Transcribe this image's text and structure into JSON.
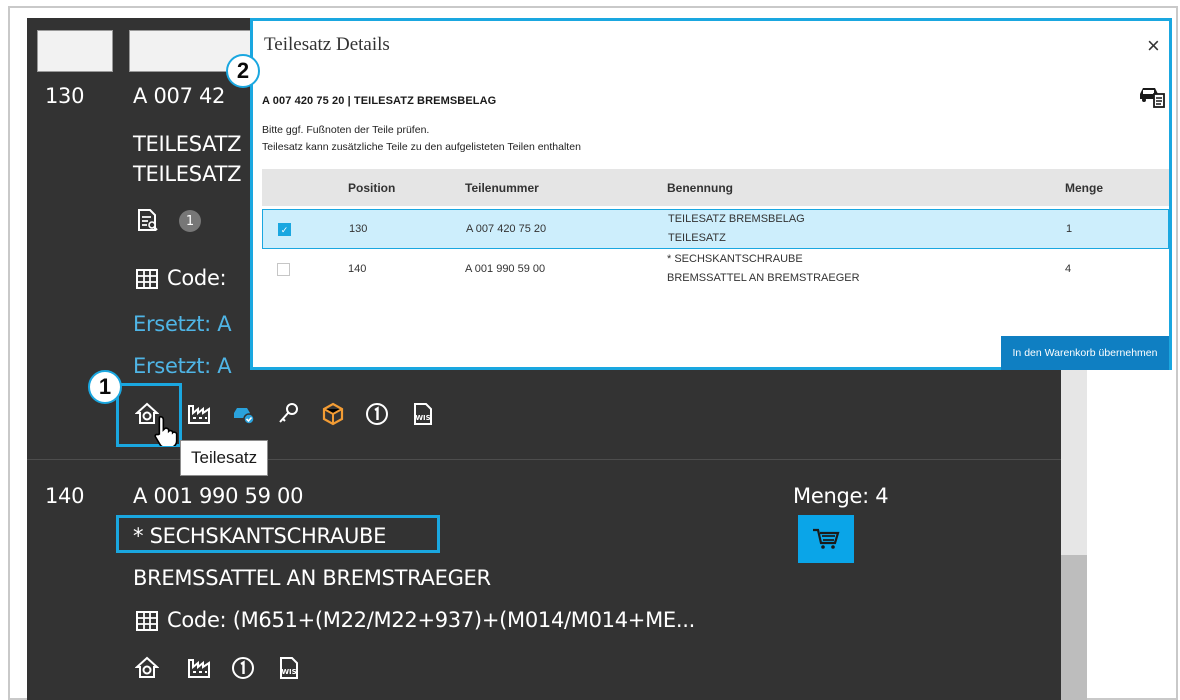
{
  "colors": {
    "accent": "#1aa7e0",
    "panel": "#333333",
    "link": "#4fb5e6",
    "cart_button": "#0aa5e8",
    "box_orange": "#f39c34",
    "car_blue": "#2aa2dc"
  },
  "list": {
    "items": [
      {
        "position": "130",
        "part_number": "A 007 42",
        "name_1": "TEILESATZ",
        "name_2": "TEILESATZ",
        "footnote_count": "1",
        "code_label": "Code:",
        "replaced_1": "Ersetzt: A",
        "replaced_2": "Ersetzt: A",
        "icons": [
          "parts-set-icon",
          "factory-icon",
          "car-check-icon",
          "key-icon",
          "package-icon",
          "info-icon",
          "wis-document-icon"
        ]
      },
      {
        "position": "140",
        "part_number": "A 001 990 59 00",
        "name_1": "* SECHSKANTSCHRAUBE",
        "name_2": "BREMSSATTEL AN BREMSTRAEGER",
        "code": "Code: (M651+(M22/M22+937)+(M014/M014+ME...",
        "quantity": "Menge: 4",
        "icons": [
          "parts-set-icon",
          "factory-icon",
          "info-icon",
          "wis-document-icon"
        ]
      }
    ]
  },
  "tooltip": {
    "text": "Teilesatz"
  },
  "callouts": {
    "one": "1",
    "two": "2"
  },
  "modal": {
    "title": "Teilesatz Details",
    "close": "×",
    "part_header": "A 007 420 75 20 | TEILESATZ BREMSBELAG",
    "note_1": "Bitte ggf. Fußnoten der Teile prüfen.",
    "note_2": "Teilesatz kann zusätzliche Teile zu den aufgelisteten Teilen enthalten",
    "columns": [
      "Position",
      "Teilenummer",
      "Benennung",
      "Menge"
    ],
    "rows": [
      {
        "checked": true,
        "position": "130",
        "part_number": "A 007 420 75 20",
        "name_1": "TEILESATZ BREMSBELAG",
        "name_2": "TEILESATZ",
        "quantity": "1"
      },
      {
        "checked": false,
        "position": "140",
        "part_number": "A 001 990 59 00",
        "name_1": "* SECHSKANTSCHRAUBE",
        "name_2": "BREMSSATTEL AN BREMSTRAEGER",
        "quantity": "4"
      }
    ],
    "add_button": "In den Warenkorb übernehmen"
  }
}
